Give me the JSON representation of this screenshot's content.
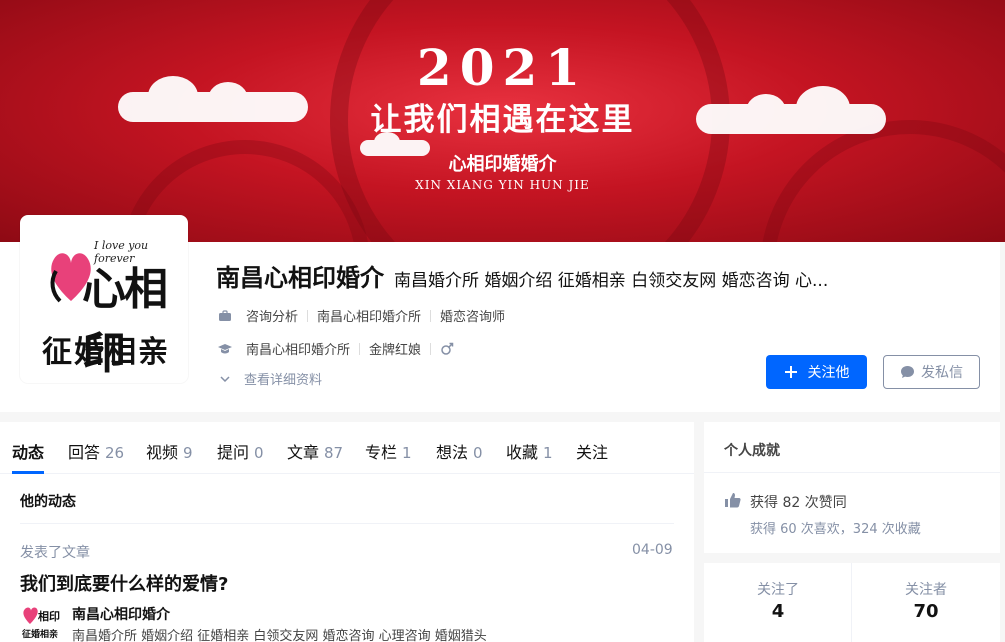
{
  "banner": {
    "year": "2021",
    "slogan": "让我们相遇在这里",
    "brand": "心相印婚婚介",
    "pinyin": "XIN XIANG YIN HUN JIE"
  },
  "avatar": {
    "script": "I love you forever",
    "big": "心相印",
    "sub": "征婚相亲"
  },
  "profile": {
    "name": "南昌心相印婚介",
    "headline": "南昌婚介所 婚姻介绍 征婚相亲 白领交友网 婚恋咨询 心...",
    "job": [
      "咨询分析",
      "南昌心相印婚介所",
      "婚恋咨询师"
    ],
    "education": [
      "南昌心相印婚介所",
      "金牌红娘"
    ],
    "gender_icon": "male-icon",
    "details_label": "查看详细资料",
    "follow_label": "关注他",
    "message_label": "发私信"
  },
  "tabs": [
    {
      "label": "动态",
      "count": ""
    },
    {
      "label": "回答",
      "count": "26"
    },
    {
      "label": "视频",
      "count": "9"
    },
    {
      "label": "提问",
      "count": "0"
    },
    {
      "label": "文章",
      "count": "87"
    },
    {
      "label": "专栏",
      "count": "1"
    },
    {
      "label": "想法",
      "count": "0"
    },
    {
      "label": "收藏",
      "count": "1"
    },
    {
      "label": "关注",
      "count": ""
    }
  ],
  "feed": {
    "section_title": "他的动态",
    "activity_meta": "发表了文章",
    "activity_date": "04-09",
    "activity_title": "我们到底要什么样的爱情?",
    "author_name": "南昌心相印婚介",
    "author_headline": "南昌婚介所 婚姻介绍 征婚相亲 白领交友网 婚恋咨询 心理咨询 婚姻猎头"
  },
  "achievements": {
    "title": "个人成就",
    "likes": "获得 82 次赞同",
    "likes_sub": "获得 60 次喜欢，324 次收藏"
  },
  "stats": {
    "following_label": "关注了",
    "following_value": "4",
    "followers_label": "关注者",
    "followers_value": "70"
  },
  "colors": {
    "accent": "#0066ff",
    "banner_red": "#c41422",
    "muted": "#8590a6",
    "avatar_pink": "#e8417a"
  }
}
